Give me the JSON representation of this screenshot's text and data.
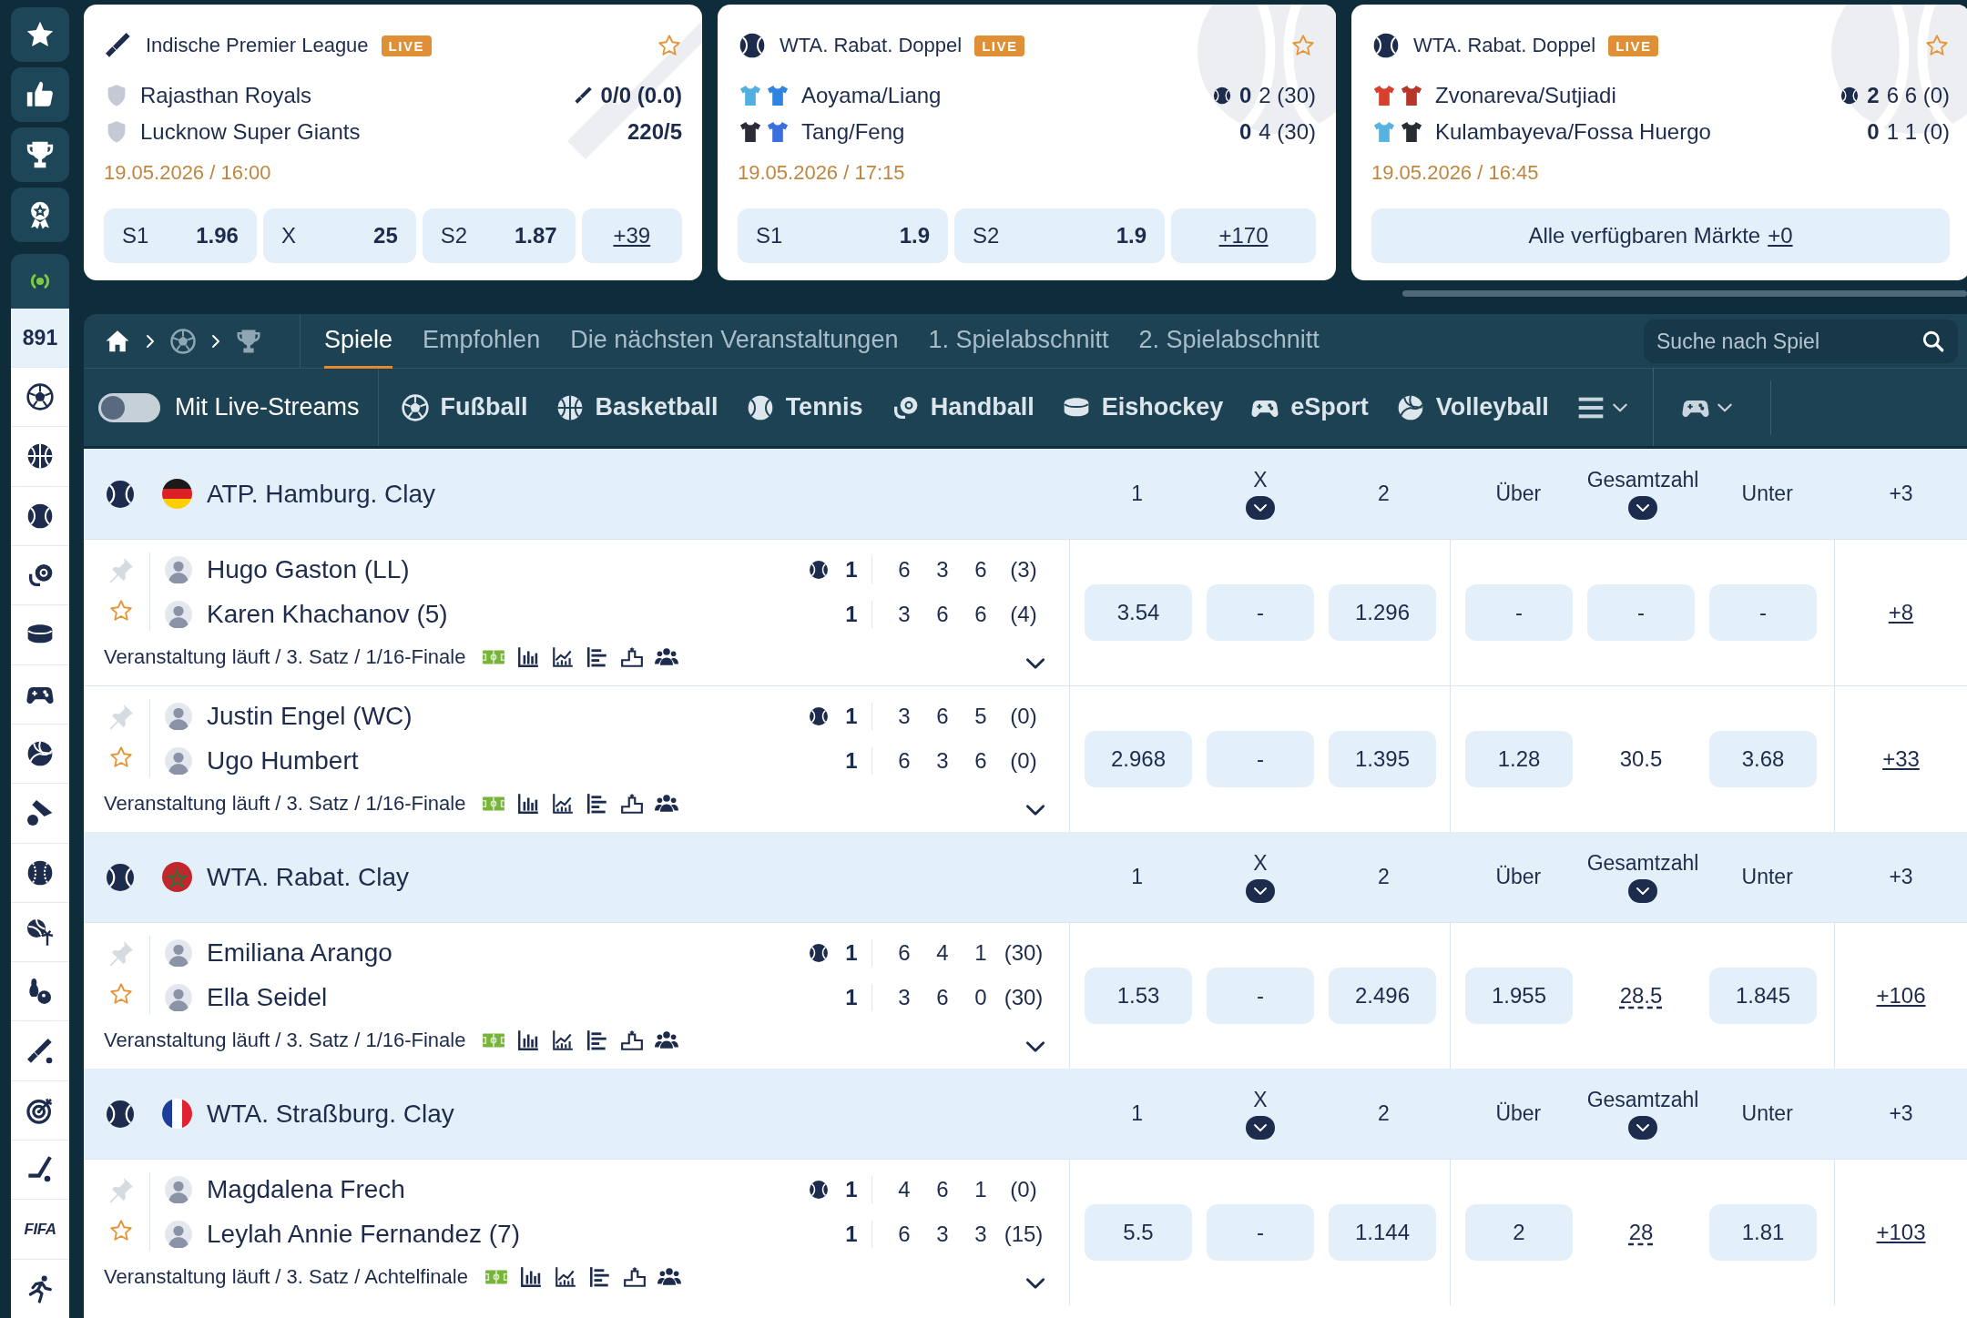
{
  "sidebar": {
    "live_count": "891",
    "sports": [
      {
        "kind": "football"
      },
      {
        "kind": "basketball"
      },
      {
        "kind": "tennis"
      },
      {
        "kind": "handball"
      },
      {
        "kind": "hockey"
      },
      {
        "kind": "esport"
      },
      {
        "kind": "volleyball"
      },
      {
        "kind": "badminton"
      },
      {
        "kind": "baseball"
      },
      {
        "kind": "beach"
      },
      {
        "kind": "bowling"
      },
      {
        "kind": "cricket"
      },
      {
        "kind": "darts"
      },
      {
        "kind": "fieldhockey"
      },
      {
        "kind": "text",
        "label": "FIFA"
      },
      {
        "kind": "athletics"
      }
    ]
  },
  "live_cards": [
    {
      "kind": "cricket",
      "league": "Indische Premier League",
      "badge": "LIVE",
      "favorite": false,
      "teams": [
        {
          "name": "Rajasthan Royals",
          "kind": "crest",
          "serving": true,
          "score": "0/0 (0.0)"
        },
        {
          "name": "Lucknow Super Giants",
          "kind": "crest",
          "serving": false,
          "score": "220/5"
        }
      ],
      "date": "19.05.2026 / 16:00",
      "odds": [
        {
          "label": "S1",
          "value": "1.96"
        },
        {
          "label": "X",
          "value": "25"
        },
        {
          "label": "S2",
          "value": "1.87"
        }
      ],
      "more": "+39"
    },
    {
      "kind": "tennis",
      "league": "WTA. Rabat. Doppel",
      "badge": "LIVE",
      "favorite": false,
      "teams": [
        {
          "name": "Aoyama/Liang",
          "kind": "jerseys",
          "jerseys": [
            {
              "color": "#52b0e0"
            },
            {
              "color": "#2f84e0"
            }
          ],
          "serving": true,
          "score": "0",
          "detail": "2 (30)"
        },
        {
          "name": "Tang/Feng",
          "kind": "jerseys",
          "jerseys": [
            {
              "color": "#2a2c36"
            },
            {
              "color": "#3a6fe0"
            }
          ],
          "serving": false,
          "score": "0",
          "detail": "4 (30)"
        }
      ],
      "date": "19.05.2026 / 17:15",
      "odds": [
        {
          "label": "S1",
          "value": "1.9"
        },
        {
          "label": "S2",
          "value": "1.9"
        }
      ],
      "more": "+170"
    },
    {
      "kind": "tennis",
      "league": "WTA. Rabat. Doppel",
      "badge": "LIVE",
      "favorite": false,
      "teams": [
        {
          "name": "Zvonareva/Sutjiadi",
          "kind": "jerseys",
          "jerseys": [
            {
              "color": "#d8402e"
            },
            {
              "color": "#b8352a"
            }
          ],
          "serving": true,
          "score": "2",
          "detail": "6 6 (0)"
        },
        {
          "name": "Kulambayeva/Fossa Huergo",
          "kind": "jerseys",
          "jerseys": [
            {
              "color": "#58b2e0"
            },
            {
              "color": "#2a2c33"
            }
          ],
          "serving": false,
          "score": "0",
          "detail": "1 1 (0)"
        }
      ],
      "date": "19.05.2026 / 16:45",
      "all_markets": "Alle verfügbaren Märkte",
      "more": "+0"
    }
  ],
  "nav": {
    "tabs": [
      {
        "label": "Spiele",
        "selected": true
      },
      {
        "label": "Empfohlen",
        "selected": false
      },
      {
        "label": "Die nächsten Veranstaltungen",
        "selected": false
      },
      {
        "label": "1. Spielabschnitt",
        "selected": false
      },
      {
        "label": "2. Spielabschnitt",
        "selected": false
      }
    ],
    "search": {
      "placeholder": "Suche nach Spiel"
    }
  },
  "filters": {
    "live_streams": {
      "label": "Mit Live-Streams",
      "on": false
    },
    "sports": [
      {
        "kind": "football",
        "label": "Fußball"
      },
      {
        "kind": "basketball",
        "label": "Basketball"
      },
      {
        "kind": "tennis",
        "label": "Tennis"
      },
      {
        "kind": "handball",
        "label": "Handball"
      },
      {
        "kind": "hockey",
        "label": "Eishockey"
      },
      {
        "kind": "esport",
        "label": "eSport"
      },
      {
        "kind": "volleyball",
        "label": "Volleyball"
      }
    ]
  },
  "groups": [
    {
      "flag": {
        "kind": "de"
      },
      "name": "ATP. Hamburg. Clay",
      "columns": [
        {
          "label": "1",
          "dropdown": false
        },
        {
          "label": "X",
          "dropdown": true
        },
        {
          "label": "2",
          "dropdown": false
        },
        {
          "label": "Über",
          "dropdown": false
        },
        {
          "label": "Gesamtzahl",
          "dropdown": true
        },
        {
          "label": "Unter",
          "dropdown": false
        },
        {
          "label": "+3",
          "dropdown": false
        }
      ],
      "matches": [
        {
          "pinned": false,
          "favorite": false,
          "players": [
            {
              "name": "Hugo Gaston (LL)",
              "serving": true,
              "sets": "1",
              "games": [
                "6",
                "3",
                "6",
                "(3)"
              ]
            },
            {
              "name": "Karen Khachanov (5)",
              "serving": false,
              "sets": "1",
              "games": [
                "3",
                "6",
                "6",
                "(4)"
              ]
            }
          ],
          "status": "Veranstaltung läuft / 3. Satz / 1/16-Finale",
          "odds": [
            {
              "kind": "button",
              "value": "3.54"
            },
            {
              "kind": "button",
              "value": "-"
            },
            {
              "kind": "button",
              "value": "1.296"
            },
            {
              "kind": "button",
              "value": "-"
            },
            {
              "kind": "button",
              "value": "-"
            },
            {
              "kind": "button",
              "value": "-"
            }
          ],
          "more": "+8"
        },
        {
          "pinned": false,
          "favorite": false,
          "players": [
            {
              "name": "Justin Engel (WC)",
              "serving": true,
              "sets": "1",
              "games": [
                "3",
                "6",
                "5",
                "(0)"
              ]
            },
            {
              "name": "Ugo Humbert",
              "serving": false,
              "sets": "1",
              "games": [
                "6",
                "3",
                "6",
                "(0)"
              ]
            }
          ],
          "status": "Veranstaltung läuft / 3. Satz / 1/16-Finale",
          "odds": [
            {
              "kind": "button",
              "value": "2.968"
            },
            {
              "kind": "button",
              "value": "-"
            },
            {
              "kind": "button",
              "value": "1.395"
            },
            {
              "kind": "button",
              "value": "1.28"
            },
            {
              "kind": "plain",
              "value": "30.5"
            },
            {
              "kind": "button",
              "value": "3.68"
            }
          ],
          "more": "+33"
        }
      ]
    },
    {
      "flag": {
        "kind": "ma"
      },
      "name": "WTA. Rabat. Clay",
      "columns": [
        {
          "label": "1",
          "dropdown": false
        },
        {
          "label": "X",
          "dropdown": true
        },
        {
          "label": "2",
          "dropdown": false
        },
        {
          "label": "Über",
          "dropdown": false
        },
        {
          "label": "Gesamtzahl",
          "dropdown": true
        },
        {
          "label": "Unter",
          "dropdown": false
        },
        {
          "label": "+3",
          "dropdown": false
        }
      ],
      "matches": [
        {
          "pinned": false,
          "favorite": false,
          "players": [
            {
              "name": "Emiliana Arango",
              "serving": true,
              "sets": "1",
              "games": [
                "6",
                "4",
                "1",
                "(30)"
              ]
            },
            {
              "name": "Ella Seidel",
              "serving": false,
              "sets": "1",
              "games": [
                "3",
                "6",
                "0",
                "(30)"
              ]
            }
          ],
          "status": "Veranstaltung läuft / 3. Satz / 1/16-Finale",
          "odds": [
            {
              "kind": "button",
              "value": "1.53"
            },
            {
              "kind": "button",
              "value": "-"
            },
            {
              "kind": "button",
              "value": "2.496"
            },
            {
              "kind": "button",
              "value": "1.955"
            },
            {
              "kind": "dotted",
              "value": "28.5"
            },
            {
              "kind": "button",
              "value": "1.845"
            }
          ],
          "more": "+106"
        }
      ]
    },
    {
      "flag": {
        "kind": "fr"
      },
      "name": "WTA. Straßburg. Clay",
      "columns": [
        {
          "label": "1",
          "dropdown": false
        },
        {
          "label": "X",
          "dropdown": true
        },
        {
          "label": "2",
          "dropdown": false
        },
        {
          "label": "Über",
          "dropdown": false
        },
        {
          "label": "Gesamtzahl",
          "dropdown": true
        },
        {
          "label": "Unter",
          "dropdown": false
        },
        {
          "label": "+3",
          "dropdown": false
        }
      ],
      "matches": [
        {
          "pinned": false,
          "favorite": false,
          "players": [
            {
              "name": "Magdalena Frech",
              "serving": true,
              "sets": "1",
              "games": [
                "4",
                "6",
                "1",
                "(0)"
              ]
            },
            {
              "name": "Leylah Annie Fernandez (7)",
              "serving": false,
              "sets": "1",
              "games": [
                "6",
                "3",
                "3",
                "(15)"
              ]
            }
          ],
          "status": "Veranstaltung läuft / 3. Satz / Achtelfinale",
          "odds": [
            {
              "kind": "button",
              "value": "5.5"
            },
            {
              "kind": "button",
              "value": "-"
            },
            {
              "kind": "button",
              "value": "1.144"
            },
            {
              "kind": "button",
              "value": "2"
            },
            {
              "kind": "dotted",
              "value": "28"
            },
            {
              "kind": "button",
              "value": "1.81"
            }
          ],
          "more": "+103"
        }
      ]
    }
  ]
}
